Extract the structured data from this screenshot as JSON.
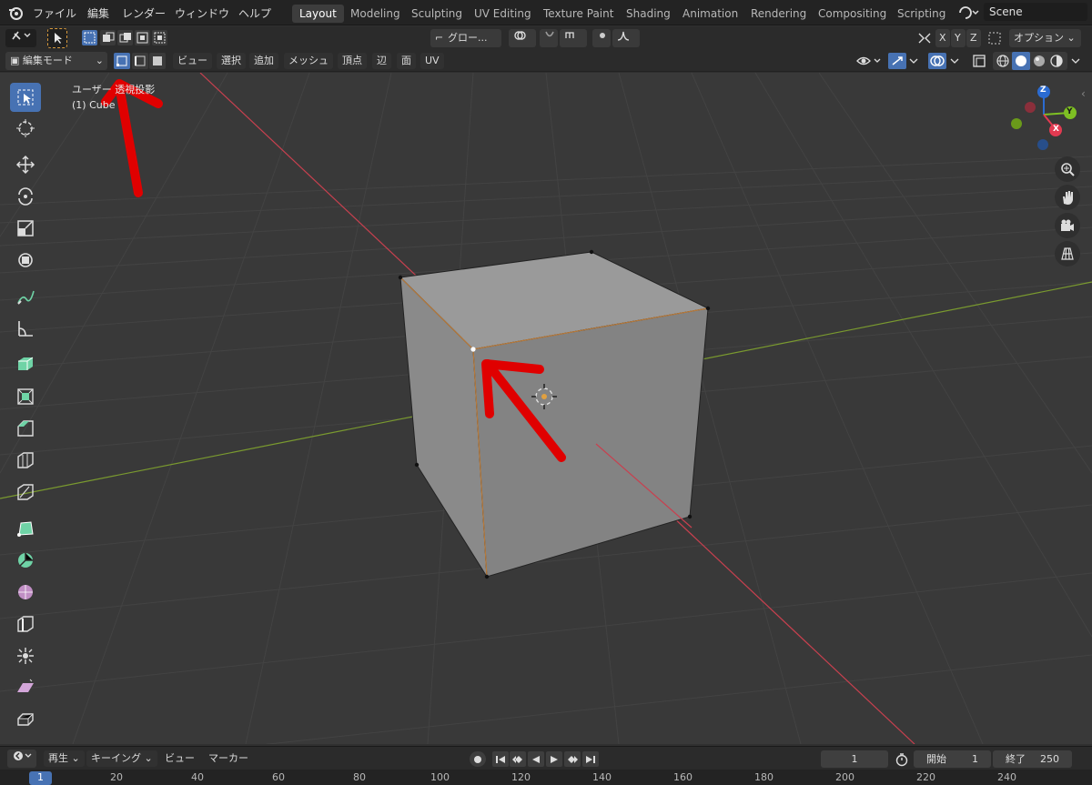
{
  "topbar": {
    "menus": [
      "ファイル",
      "編集",
      "レンダー",
      "ウィンドウ",
      "ヘルプ"
    ],
    "workspaces": [
      "Layout",
      "Modeling",
      "Sculpting",
      "UV Editing",
      "Texture Paint",
      "Shading",
      "Animation",
      "Rendering",
      "Compositing",
      "Scripting"
    ],
    "active_workspace": "Layout",
    "scene": "Scene"
  },
  "tool_header": {
    "transform_orientation": "グロー...",
    "xyz": [
      "X",
      "Y",
      "Z"
    ],
    "options_label": "オプション"
  },
  "editor_header": {
    "mode": "編集モード",
    "menus": [
      "ビュー",
      "選択",
      "追加",
      "メッシュ",
      "頂点",
      "辺",
      "面",
      "UV"
    ]
  },
  "viewport": {
    "view_name": "ユーザー 透視投影",
    "object_name": "(1) Cube",
    "gizmo_axes": {
      "x": "X",
      "y": "Y",
      "z": "Z"
    }
  },
  "timeline": {
    "menus": [
      "再生",
      "キーイング",
      "ビュー",
      "マーカー"
    ],
    "current_frame": "1",
    "start_label": "開始",
    "start_value": "1",
    "end_label": "終了",
    "end_value": "250",
    "ruler": [
      "1",
      "20",
      "40",
      "60",
      "80",
      "100",
      "120",
      "140",
      "160",
      "180",
      "200",
      "220",
      "240"
    ]
  },
  "colors": {
    "accent": "#4772b3",
    "annotation_arrow": "#e00000",
    "x_axis": "#c8404f",
    "y_axis": "#7a9a2f"
  }
}
